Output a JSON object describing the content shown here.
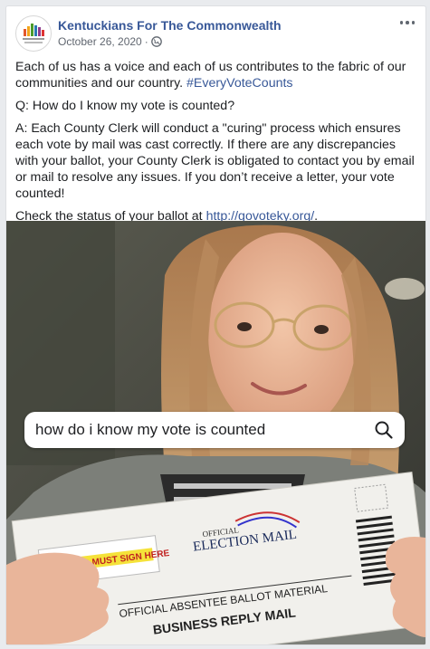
{
  "post": {
    "page_name": "Kentuckians For The Commonwealth",
    "date": "October 26, 2020",
    "date_separator": "·",
    "paragraph1_prefix": "Each of us has a voice and each of us contributes to the fabric of our communities and our country. ",
    "hashtag": "#EveryVoteCounts",
    "question": "Q: How do I know my vote is counted?",
    "answer": "A: Each County Clerk will conduct a \"curing\" process which ensures each vote by mail was cast correctly. If there are any discrepancies with your ballot, your County Clerk is obligated to contact you by email or mail to resolve any issues. If you don’t receive a letter, your vote counted!",
    "check_prefix": "Check the status of your ballot at ",
    "check_link": "http://govoteky.org/",
    "check_suffix": "."
  },
  "photo": {
    "search_query": "how do i know my vote is counted",
    "envelope": {
      "voter_sign_label": "VOTER MUST SIGN HERE",
      "election_mail_top": "OFFICIAL",
      "election_mail_label": "ELECTION MAIL",
      "absentee_label": "OFFICIAL ABSENTEE BALLOT MATERIAL",
      "reply_label": "BUSINESS REPLY MAIL"
    }
  },
  "colors": {
    "link": "#385898",
    "meta": "#616770",
    "text": "#1c1e21",
    "highlight": "#f5e23a"
  },
  "icons": [
    "kftc-logo-icon",
    "globe-icon",
    "more-options-icon",
    "search-icon",
    "us-flag-icon"
  ]
}
